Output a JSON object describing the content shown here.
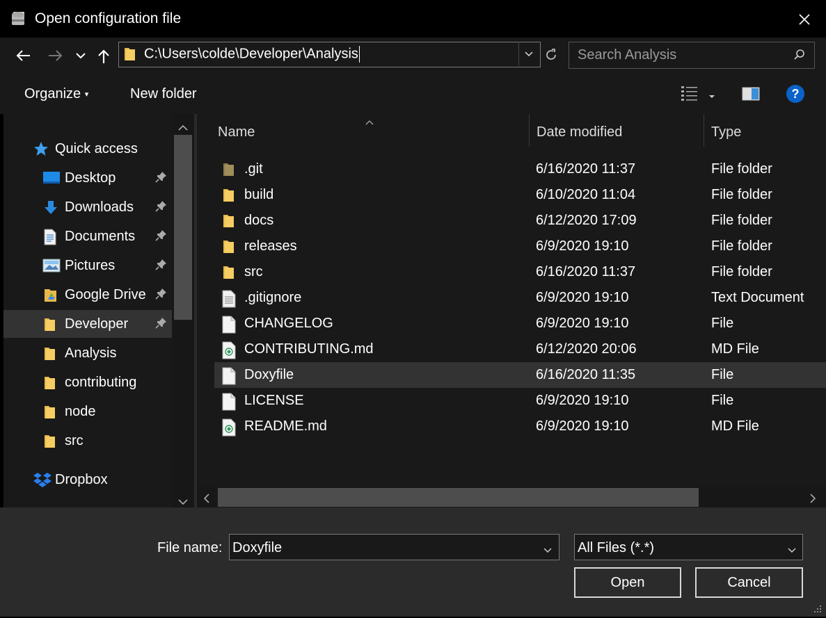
{
  "window": {
    "title": "Open configuration file"
  },
  "nav": {
    "address": "C:\\Users\\colde\\Developer\\Analysis",
    "search_placeholder": "Search Analysis"
  },
  "toolbar": {
    "organize": "Organize",
    "new_folder": "New folder"
  },
  "sidebar": {
    "items": [
      {
        "label": "Quick access",
        "icon": "star-icon",
        "pinned": false,
        "level": 0
      },
      {
        "label": "Desktop",
        "icon": "desktop-icon",
        "pinned": true,
        "level": 1
      },
      {
        "label": "Downloads",
        "icon": "download-icon",
        "pinned": true,
        "level": 1
      },
      {
        "label": "Documents",
        "icon": "document-icon",
        "pinned": true,
        "level": 1
      },
      {
        "label": "Pictures",
        "icon": "pictures-icon",
        "pinned": true,
        "level": 1
      },
      {
        "label": "Google Drive",
        "icon": "google-drive-icon",
        "pinned": true,
        "level": 1
      },
      {
        "label": "Developer",
        "icon": "folder-icon",
        "pinned": true,
        "level": 1,
        "selected": true
      },
      {
        "label": "Analysis",
        "icon": "folder-icon",
        "pinned": false,
        "level": 1
      },
      {
        "label": "contributing",
        "icon": "folder-icon",
        "pinned": false,
        "level": 1
      },
      {
        "label": "node",
        "icon": "folder-icon",
        "pinned": false,
        "level": 1
      },
      {
        "label": "src",
        "icon": "folder-icon",
        "pinned": false,
        "level": 1
      },
      {
        "label": "Dropbox",
        "icon": "dropbox-icon",
        "pinned": false,
        "level": 0
      }
    ]
  },
  "columns": {
    "name": "Name",
    "date": "Date modified",
    "type": "Type"
  },
  "files": [
    {
      "name": ".git",
      "date": "6/16/2020 11:37",
      "type": "File folder",
      "icon": "git-folder-icon"
    },
    {
      "name": "build",
      "date": "6/10/2020 11:04",
      "type": "File folder",
      "icon": "folder-icon"
    },
    {
      "name": "docs",
      "date": "6/12/2020 17:09",
      "type": "File folder",
      "icon": "folder-icon"
    },
    {
      "name": "releases",
      "date": "6/9/2020 19:10",
      "type": "File folder",
      "icon": "folder-icon"
    },
    {
      "name": "src",
      "date": "6/16/2020 11:37",
      "type": "File folder",
      "icon": "folder-icon"
    },
    {
      "name": ".gitignore",
      "date": "6/9/2020 19:10",
      "type": "Text Document",
      "icon": "text-file-icon"
    },
    {
      "name": "CHANGELOG",
      "date": "6/9/2020 19:10",
      "type": "File",
      "icon": "file-icon"
    },
    {
      "name": "CONTRIBUTING.md",
      "date": "6/12/2020 20:06",
      "type": "MD File",
      "icon": "markdown-file-icon"
    },
    {
      "name": "Doxyfile",
      "date": "6/16/2020 11:35",
      "type": "File",
      "icon": "file-icon",
      "selected": true
    },
    {
      "name": "LICENSE",
      "date": "6/9/2020 19:10",
      "type": "File",
      "icon": "file-icon"
    },
    {
      "name": "README.md",
      "date": "6/9/2020 19:10",
      "type": "MD File",
      "icon": "markdown-file-icon"
    }
  ],
  "bottom": {
    "file_name_label": "File name:",
    "file_name_value": "Doxyfile",
    "filter": "All Files (*.*)",
    "open_label": "Open",
    "cancel_label": "Cancel"
  },
  "colors": {
    "folder": "#e8b84a",
    "accent": "#0a63c9",
    "selected": "#333333"
  }
}
